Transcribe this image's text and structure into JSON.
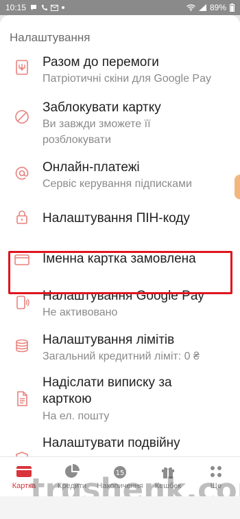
{
  "status_bar": {
    "time": "10:15",
    "battery": "89%"
  },
  "section_title": "Налаштування",
  "items": [
    {
      "title": "Разом до перемоги",
      "subtitle": "Патріотичні скіни для Google Pay",
      "icon": "trident-card-icon"
    },
    {
      "title": "Заблокувати картку",
      "subtitle_lines": [
        "Ви завжди зможете її",
        "розблокувати"
      ],
      "icon": "block-icon"
    },
    {
      "title": "Онлайн-платежі",
      "subtitle": "Сервіс керування підписками",
      "icon": "at-icon"
    },
    {
      "title": "Налаштування ПІН-коду",
      "icon": "lock-icon"
    },
    {
      "title": "Іменна картка замовлена",
      "icon": "card-icon"
    },
    {
      "title": "Налаштування Google Pay",
      "subtitle": "Не активовано",
      "icon": "phone-pay-icon"
    },
    {
      "title": "Налаштування лімітів",
      "subtitle": "Загальний кредитний ліміт: 0 ₴",
      "icon": "coins-icon"
    },
    {
      "title_lines": [
        "Надіслати виписку за",
        "карткою"
      ],
      "subtitle": "На ел. пошту",
      "icon": "document-icon"
    },
    {
      "title": "Налаштувати подвійну",
      "icon": "shield-icon"
    }
  ],
  "tabs": [
    {
      "label": "Картка",
      "icon": "card-tab-icon",
      "active": true
    },
    {
      "label": "Кредити",
      "icon": "pie-icon",
      "active": false
    },
    {
      "label": "Накопичення",
      "icon": "piggy-icon",
      "active": false
    },
    {
      "label": "Кешбек",
      "icon": "gift-icon",
      "active": false
    },
    {
      "label": "Ще",
      "icon": "dots-grid-icon",
      "active": false
    }
  ],
  "watermark": "trushenk.com",
  "colors": {
    "accent": "#e0141e",
    "icon": "#e8817c",
    "tab_active": "#d8343c",
    "handle": "#f3b77d"
  }
}
